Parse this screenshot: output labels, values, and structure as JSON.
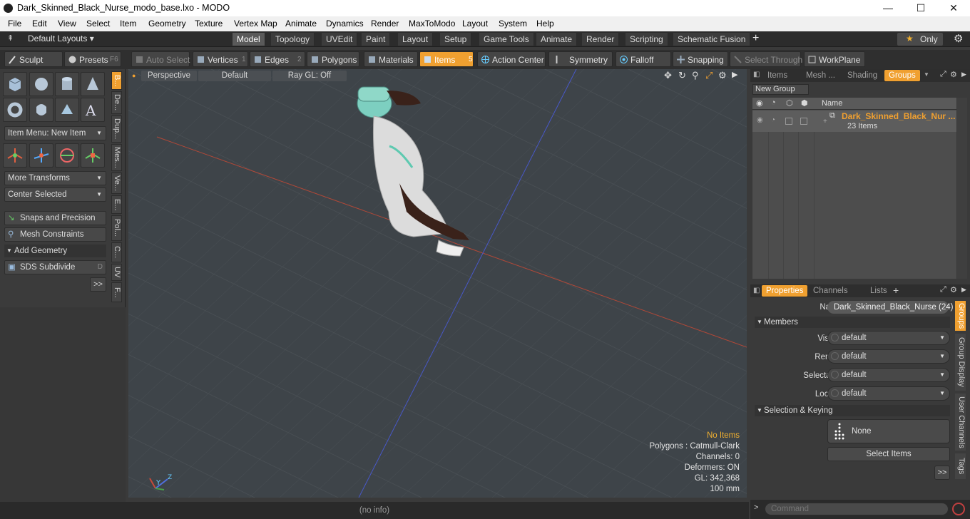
{
  "window": {
    "title": "Dark_Skinned_Black_Nurse_modo_base.lxo - MODO",
    "min": "—",
    "max": "☐",
    "close": "✕"
  },
  "menu": [
    "File",
    "Edit",
    "View",
    "Select",
    "Item",
    "Geometry",
    "Texture",
    "Vertex Map",
    "Animate",
    "Dynamics",
    "Render",
    "MaxToModo",
    "Layout",
    "System",
    "Help"
  ],
  "layouts": {
    "dropdown": "Default Layouts ▾",
    "tabs": [
      "Model",
      "Topology",
      "UVEdit",
      "Paint",
      "Layout",
      "Setup",
      "Game Tools",
      "Animate",
      "Render",
      "Scripting",
      "Schematic Fusion"
    ],
    "active_tab": "Model",
    "add": "+",
    "only": "Only",
    "star": "★",
    "gear": "⚙"
  },
  "toolbar": {
    "sculpt": "Sculpt",
    "presets": "Presets",
    "presets_key": "F6",
    "auto_select": "Auto Select",
    "vertices": "Vertices",
    "vertices_key": "1",
    "edges": "Edges",
    "edges_key": "2",
    "polygons": "Polygons",
    "materials": "Materials",
    "items": "Items",
    "items_key": "5",
    "action_center": "Action Center",
    "symmetry": "Symmetry",
    "falloff": "Falloff",
    "snapping": "Snapping",
    "select_through": "Select Through",
    "workplane": "WorkPlane"
  },
  "left": {
    "item_menu": "Item Menu: New Item",
    "more_transforms": "More Transforms",
    "center_selected": "Center Selected",
    "snaps": "Snaps and Precision",
    "mesh_constraints": "Mesh Constraints",
    "add_geometry": "Add Geometry",
    "sds": "SDS Subdivide",
    "sds_key": "D",
    "more": ">>",
    "vtabs": [
      "B...",
      "De...",
      "Dup...",
      "Mes...",
      "Ve...",
      "E...",
      "Pol...",
      "C...",
      "UV",
      "F..."
    ]
  },
  "viewport": {
    "view": "Perspective",
    "shading": "Default",
    "raygl": "Ray GL: Off",
    "stats": {
      "no_items": "No Items",
      "polygons": "Polygons : Catmull-Clark",
      "channels": "Channels: 0",
      "deformers": "Deformers: ON",
      "gl": "GL: 342,368",
      "unit": "100 mm"
    }
  },
  "status": {
    "info": "(no info)",
    "command_placeholder": "Command"
  },
  "outliner": {
    "tabs": [
      "Items",
      "Mesh ...",
      "Shading",
      "Groups"
    ],
    "active_tab": "Groups",
    "new_group": "New Group",
    "col_name": "Name",
    "group_name": "Dark_Skinned_Black_Nur ...",
    "group_count": "23 Items"
  },
  "properties": {
    "tabs": [
      "Properties",
      "Channels",
      "Lists"
    ],
    "active_tab": "Properties",
    "add": "+",
    "name_label": "Name",
    "name_value": "Dark_Skinned_Black_Nurse (24)",
    "members": "Members",
    "visible_label": "Visible",
    "visible": "default",
    "render_label": "Render",
    "render": "default",
    "selectable_label": "Selectable",
    "selectable": "default",
    "locked_label": "Locked",
    "locked": "default",
    "selection_keying": "Selection & Keying",
    "none": "None",
    "select_items": "Select Items",
    "more": ">>",
    "side_tabs": [
      "Groups",
      "Group Display",
      "User Channels",
      "Tags"
    ]
  },
  "colors": {
    "accent": "#f0a030",
    "viewport_bg": "#3e4449",
    "x_axis": "#c84a3a",
    "z_axis": "#4a5fd0"
  }
}
